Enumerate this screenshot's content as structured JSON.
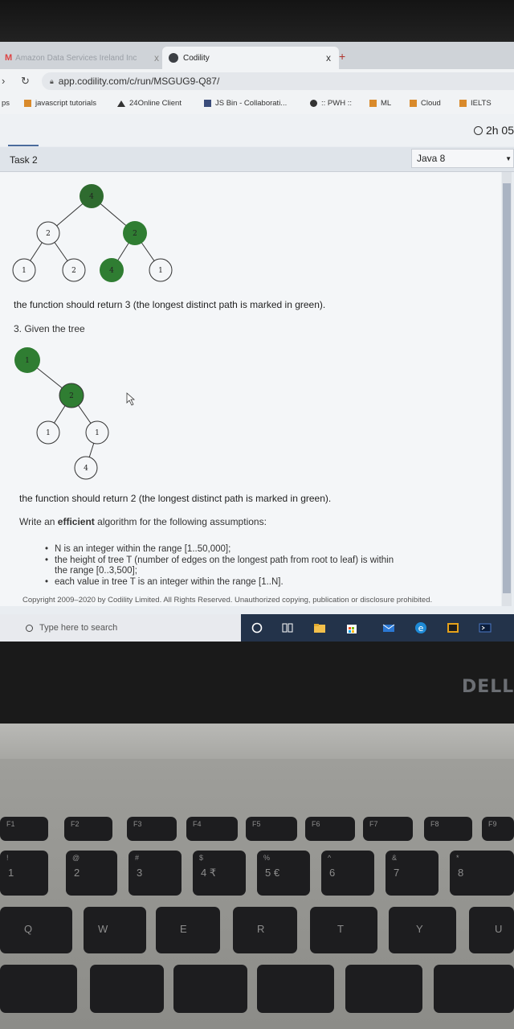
{
  "browser": {
    "tabs": [
      {
        "label": "Amazon Data Services Ireland Inc",
        "close": "x"
      },
      {
        "label": "Codility",
        "close": "x"
      }
    ],
    "new_tab": "+",
    "url": "app.codility.com/c/run/MSGUG9-Q87/",
    "bookmarks": [
      "ps",
      "javascript tutorials",
      "24Online Client",
      "JS Bin - Collaborati...",
      ":: PWH ::",
      "ML",
      "Cloud",
      "IELTS"
    ]
  },
  "header": {
    "timer": "2h 05",
    "task_label": "Task 2",
    "language": "Java 8"
  },
  "content": {
    "tree1": {
      "nodes": [
        "4",
        "2",
        "2",
        "1",
        "2",
        "4",
        "1"
      ]
    },
    "result1": "the function should return 3 (the longest distinct path is marked in green).",
    "example3": "3. Given the tree",
    "tree2": {
      "nodes": [
        "1",
        "2",
        "1",
        "1",
        "4"
      ]
    },
    "result2": "the function should return 2 (the longest distinct path is marked in green).",
    "intro_prefix": "Write an ",
    "intro_bold": "efficient",
    "intro_suffix": " algorithm for the following assumptions:",
    "assumptions": [
      "N is an integer within the range [1..50,000];",
      "the height of tree T (number of edges on the longest path from root to leaf) is within",
      "the range [0..3,500];",
      "each value in tree T is an integer within the range [1..N]."
    ],
    "copyright": "Copyright 2009–2020 by Codility Limited. All Rights Reserved. Unauthorized copying, publication or disclosure prohibited."
  },
  "taskbar": {
    "search_placeholder": "Type here to search"
  },
  "laptop": {
    "brand": "DELL",
    "fn_keys": [
      "F1",
      "F2",
      "F3",
      "F4",
      "F5",
      "F6",
      "F7",
      "F8",
      "F9"
    ],
    "num_keys": [
      [
        "!",
        "1"
      ],
      [
        "@",
        "2"
      ],
      [
        "#",
        "3"
      ],
      [
        "$",
        "4 ₹"
      ],
      [
        "%",
        "5 €"
      ],
      [
        "^",
        "6"
      ],
      [
        "&",
        "7"
      ],
      [
        "*",
        "8"
      ]
    ],
    "letter_keys": [
      "Q",
      "W",
      "E",
      "R",
      "T",
      "Y",
      "U"
    ]
  },
  "colors": {
    "green": "#2f7d32",
    "green_dark": "#2e6b2f",
    "accent": "#4b6c9c"
  }
}
